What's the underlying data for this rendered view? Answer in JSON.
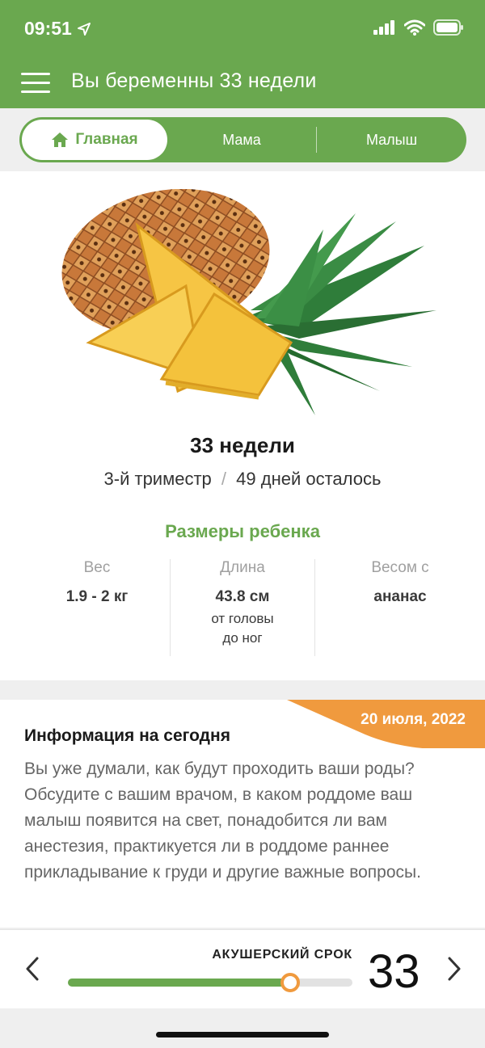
{
  "status": {
    "time": "09:51"
  },
  "app": {
    "title": "Вы беременны 33 недели"
  },
  "tabs": [
    {
      "label": "Главная",
      "active": true
    },
    {
      "label": "Мама",
      "active": false
    },
    {
      "label": "Малыш",
      "active": false
    }
  ],
  "week": {
    "title": "33 недели",
    "trimester": "3-й триместр",
    "separator": "/",
    "remaining": "49 дней осталось"
  },
  "sizes": {
    "title": "Размеры ребенка",
    "weight": {
      "label": "Вес",
      "value": "1.9 - 2 кг"
    },
    "length": {
      "label": "Длина",
      "value": "43.8 см",
      "note1": "от головы",
      "note2": "до ног"
    },
    "compare": {
      "label": "Весом с",
      "value": "ананас"
    }
  },
  "info": {
    "date": "20 июля, 2022",
    "title": "Информация на сегодня",
    "text": "Вы уже думали, как будут проходить ваши роды? Обсудите с вашим врачом, в каком роддоме ваш малыш появится на свет, понадобится ли вам анестезия, практикуется ли в роддоме раннее прикладывание к груди и другие важные вопросы."
  },
  "term": {
    "label": "АКУШЕРСКИЙ СРОК",
    "value": "33",
    "progress": 0.78
  },
  "colors": {
    "brand_green": "#6aa84f",
    "accent_orange": "#f09a3e"
  },
  "icons": [
    "location-arrow-icon",
    "signal-icon",
    "wifi-icon",
    "battery-icon",
    "menu-icon",
    "home-icon",
    "pineapple-image",
    "chevron-left-icon",
    "chevron-right-icon"
  ]
}
